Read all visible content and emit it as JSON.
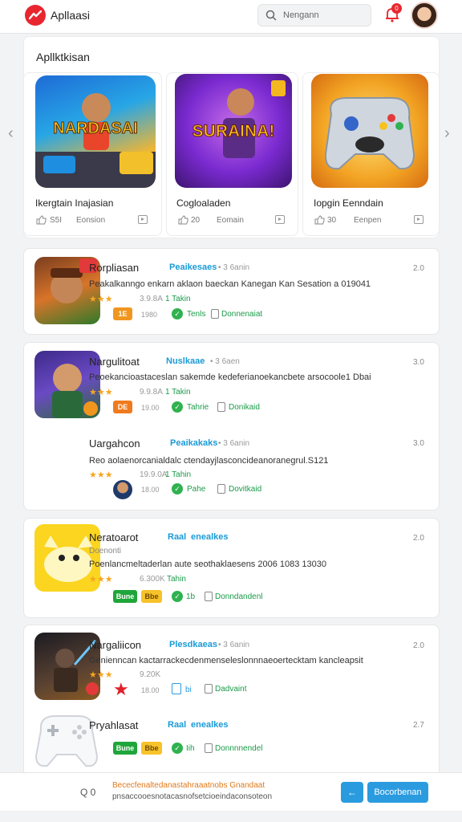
{
  "header": {
    "app_title": "Apllaasi",
    "search_placeholder": "Nengann",
    "notification_count": "0"
  },
  "featured": {
    "title": "Apllktkisan",
    "items": [
      {
        "name": "Ikergtain Inajasian",
        "count": "S5I",
        "type": "Eonsion",
        "art_text": "NARDASAI"
      },
      {
        "name": "Cogloaladen",
        "count": "20",
        "type": "Eomain",
        "art_text": "SURAINA!"
      },
      {
        "name": "Iopgin Eenndain",
        "count": "30",
        "type": "Eenpen",
        "art_text": ""
      }
    ]
  },
  "list": [
    {
      "name": "Rorpliasan",
      "tag": "Peaikesaes",
      "meta": "• 3 6anin",
      "size": "2.0",
      "desc": "Peakalkanngo enkarn aklaon baeckan Kanegan Kan Sesation a 019041",
      "rating": "3.9.8A",
      "downloads": "1 Takin",
      "pill1": "1E",
      "count": "1980",
      "status": "Tenls",
      "dl_label": "Donnenaiat"
    },
    {
      "name": "Nargulitoat",
      "tag": "Nuslkaae",
      "meta": "• 3 6aen",
      "size": "3.0",
      "desc": "Peoekancioastaceslan sakemde kedeferianoekancbete arsocoole1 Dbai",
      "rating": "9.9.8A",
      "downloads": "1 Takin",
      "pill1": "DE",
      "count": "19.00",
      "status": "Tahrie",
      "dl_label": "Donikaid"
    },
    {
      "name": "Uargahcon",
      "tag": "Peaikakaks",
      "meta": "• 3 6anin",
      "size": "3.0",
      "desc": "Reo aolaenorcanialdalc ctendayjlasconcideanoranegrul.S121",
      "rating": "19.9.0A",
      "downloads": "1 Tahin",
      "count": "18.00",
      "status": "Pahe",
      "dl_label": "Dovitkaid"
    },
    {
      "name": "Neratoarot",
      "tag": "Raal",
      "tag2": "enealkes",
      "meta": "",
      "size": "2.0",
      "note": "Doenonti",
      "desc": "Poenlancmeltaderlan aute seothaklaesens 2006 1083 13030",
      "rating": "6.300K",
      "downloads": "Tahin",
      "pill1": "Bune",
      "pill2": "Bbe",
      "status": "1b",
      "dl_label": "Donndandenl"
    },
    {
      "name": "Nargaliicon",
      "tag": "Plesdkaeas",
      "meta": "• 3 6anin",
      "size": "2.0",
      "desc": "Genienncan kactarrackecdenmenseleslonnnaeoertecktam kancleapsit",
      "rating": "9.20K",
      "count": "18.00",
      "status": "bi",
      "dl_label": "Dadvaint"
    },
    {
      "name": "Pryahlasat",
      "tag": "Raal",
      "tag2": "enealkes",
      "meta": "",
      "size": "2.7",
      "pill1": "Bune",
      "pill2": "Bbe",
      "status": "Iih",
      "dl_label": "Donnnnendel"
    }
  ],
  "bottom": {
    "icons": "Q 0",
    "line1": "Bececfenaltedanastahraaatnobs Gnandaat",
    "line2": "pnsaccooesnotacasnofsetcioeindaconsoteon",
    "button": "Bocorbenan"
  },
  "colors": {
    "accent": "#2b9be0",
    "brand": "#e8262f",
    "green": "#2fb24f",
    "star": "#f5a623"
  }
}
